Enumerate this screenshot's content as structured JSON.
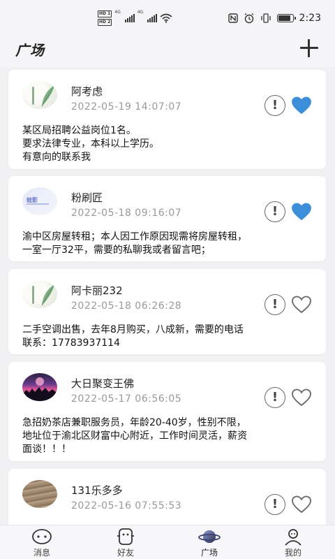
{
  "status_bar": {
    "sim1": "HD 1",
    "sim2": "HD 2",
    "net1": "4G",
    "net2": "4G",
    "time": "2:23",
    "battery_level": 0.85
  },
  "header": {
    "title": "广场"
  },
  "posts": [
    {
      "name": "阿考虑",
      "time": "2022-05-19 14:07:07",
      "content": "某区局招聘公益岗位1名。\n要求法律专业，本科以上学历。\n有意向的联系我",
      "liked": true,
      "avatar": "plant"
    },
    {
      "name": "粉刷匠",
      "time": "2022-05-18 09:16:07",
      "content": "渝中区房屋转租；本人因工作原因现需将房屋转租，\n一室一厅32平，需要的私聊我或者留言吧；",
      "liked": true,
      "avatar": "brand",
      "avatar_text": "蛙影"
    },
    {
      "name": "阿卡丽232",
      "time": "2022-05-18 06:26:28",
      "content": "二手空调出售，去年8月购买，八成新，需要的电话\n联系：17783937114",
      "liked": false,
      "avatar": "plant"
    },
    {
      "name": "大日聚变王佛",
      "time": "2022-05-17 06:56:05",
      "content": "急招奶茶店兼职服务员，年龄20-40岁，性别不限，\n地址位于渝北区财富中心附近，工作时间灵活，薪资\n面谈！！！",
      "liked": false,
      "avatar": "concert"
    },
    {
      "name": "131乐多多",
      "time": "2022-05-16 07:55:53",
      "content": "",
      "liked": false,
      "avatar": "wood"
    }
  ],
  "report_symbol": "!",
  "nav": [
    {
      "label": "消息",
      "icon": "message-icon"
    },
    {
      "label": "好友",
      "icon": "friends-icon"
    },
    {
      "label": "广场",
      "icon": "planet-icon",
      "active": true
    },
    {
      "label": "我的",
      "icon": "profile-icon"
    }
  ],
  "colors": {
    "accent": "#3a8fd8",
    "background": "#f1f1f3"
  }
}
